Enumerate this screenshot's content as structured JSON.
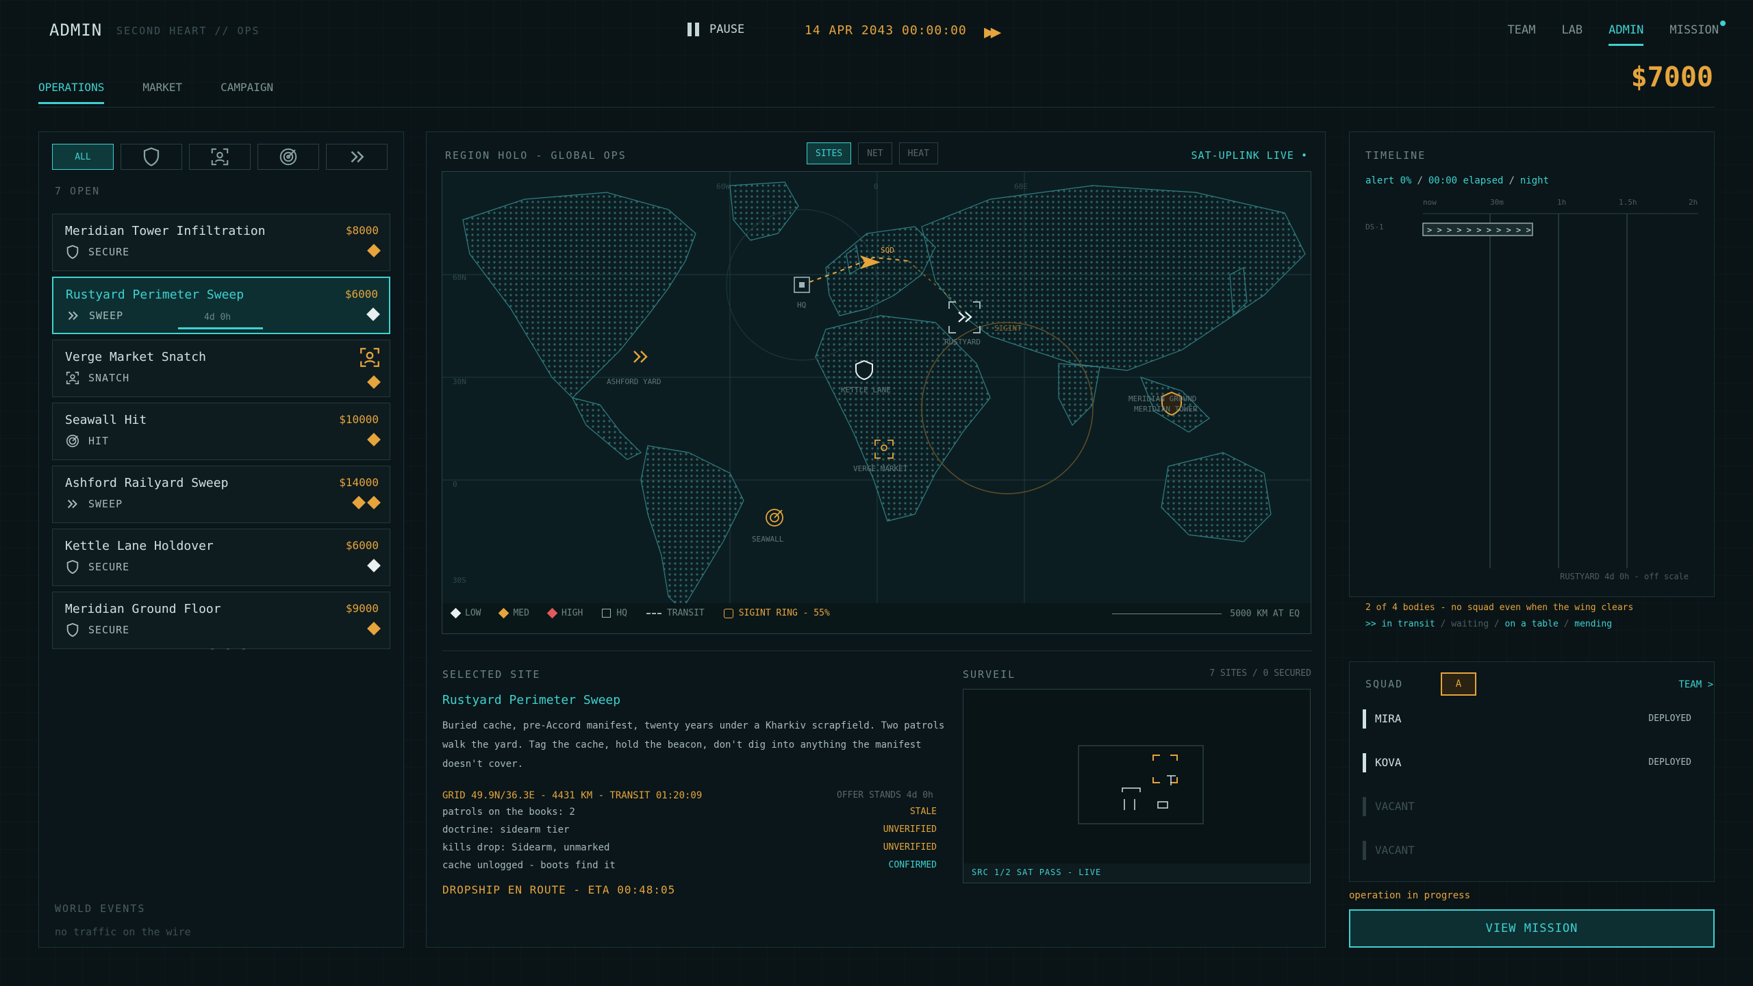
{
  "header": {
    "brand": "ADMIN",
    "sub_brand": "SECOND HEART // OPS",
    "pause_label": "PAUSE",
    "date": "14 APR 2043  00:00:00",
    "nav": [
      "TEAM",
      "LAB",
      "ADMIN",
      "MISSION"
    ],
    "active_nav": "ADMIN",
    "tabs": [
      "OPERATIONS",
      "MARKET",
      "CAMPAIGN"
    ],
    "active_tab": "OPERATIONS",
    "money": "$7000"
  },
  "operations": {
    "filter_all": "ALL",
    "open_count": "7 OPEN",
    "items": [
      {
        "name": "Meridian Tower Infiltration",
        "reward": "$8000",
        "type": "SECURE",
        "icon": "shield-icon",
        "difficulty": [
          "med"
        ]
      },
      {
        "name": "Rustyard Perimeter Sweep",
        "reward": "$6000",
        "type": "SWEEP",
        "icon": "chevrons-icon",
        "difficulty": [
          "low"
        ],
        "timer": "4d 0h"
      },
      {
        "name": "Verge Market Snatch",
        "reward": "",
        "type": "SNATCH",
        "icon": "target-person-icon",
        "difficulty": [
          "med"
        ]
      },
      {
        "name": "Seawall Hit",
        "reward": "$10000",
        "type": "HIT",
        "icon": "crosshair-icon",
        "difficulty": [
          "med"
        ]
      },
      {
        "name": "Ashford Railyard Sweep",
        "reward": "$14000",
        "type": "SWEEP",
        "icon": "chevrons-icon",
        "difficulty": [
          "med",
          "med"
        ]
      },
      {
        "name": "Kettle Lane Holdover",
        "reward": "$6000",
        "type": "SECURE",
        "icon": "shield-icon",
        "difficulty": [
          "low"
        ]
      },
      {
        "name": "Meridian Ground Floor",
        "reward": "$9000",
        "type": "SECURE",
        "icon": "shield-icon",
        "difficulty": [
          "med"
        ]
      }
    ],
    "more": "- - -",
    "world_events_title": "WORLD EVENTS",
    "world_events_text": "no traffic on the wire"
  },
  "map": {
    "title": "REGION HOLO - GLOBAL OPS",
    "modes": [
      "SITES",
      "NET",
      "HEAT"
    ],
    "active_mode": "SITES",
    "uplink": "SAT-UPLINK LIVE •",
    "labels": {
      "hq": "HQ",
      "sqd": "SQD",
      "rustyard": "RUSTYARD",
      "sigint": "SIGINT",
      "kettle": "KETTLE LANE",
      "ashford": "ASHFORD YARD",
      "verge": "VERGE MARKET",
      "seawall": "SEAWALL",
      "meridian": "MERIDIAN GROUND",
      "meridian_tower": "MERIDIAN TOWER",
      "lat60": "60N",
      "lat30": "30N",
      "lat0": "0",
      "lat30s": "30S",
      "lon60w": "60W",
      "lon0": "0",
      "lon60e": "60E"
    },
    "legend": {
      "low": "LOW",
      "med": "MED",
      "high": "HIGH",
      "hq": "HQ",
      "transit": "TRANSIT",
      "sigint": "SIGINT RING - 55%"
    },
    "scale": "5000 KM AT EQ"
  },
  "selected_site": {
    "label": "SELECTED SITE",
    "name": "Rustyard Perimeter Sweep",
    "description": "Buried cache, pre-Accord manifest, twenty years under a Kharkiv scrapfield. Two patrols walk the yard. Tag the cache, hold the beacon, don't dig into anything the manifest doesn't cover.",
    "grid": "GRID 49.9N/36.3E - 4431 KM - TRANSIT 01:20:09",
    "offer": "OFFER STANDS 4d 0h",
    "intel": [
      {
        "text": "patrols on the books: 2",
        "status": "STALE",
        "ok": false
      },
      {
        "text": "doctrine: sidearm tier",
        "status": "UNVERIFIED",
        "ok": false
      },
      {
        "text": "kills drop: Sidearm, unmarked",
        "status": "UNVERIFIED",
        "ok": false
      },
      {
        "text": "cache unlogged - boots find it",
        "status": "CONFIRMED",
        "ok": true
      }
    ],
    "dropship": "DROPSHIP EN ROUTE - ETA 00:48:05"
  },
  "surveil": {
    "label": "SURVEIL",
    "count": "7 SITES / 0 SECURED",
    "footer": "SRC 1/2  SAT PASS - LIVE"
  },
  "timeline": {
    "title": "TIMELINE",
    "alert": "alert 0%",
    "elapsed": "00:00 elapsed",
    "phase": "night",
    "ticks": [
      "now",
      "30m",
      "1h",
      "1.5h",
      "2h"
    ],
    "row_label": "DS-1",
    "offscale": "RUSTYARD 4d 0h - off scale",
    "note1": "2 of 4 bodies - no squad even when the wing clears",
    "note2_parts": [
      ">> in transit",
      "waiting",
      "on a table",
      "mending"
    ]
  },
  "squad": {
    "label": "SQUAD",
    "chip": "A",
    "team_link": "TEAM >",
    "members": [
      {
        "name": "MIRA",
        "status": "DEPLOYED",
        "vacant": false
      },
      {
        "name": "KOVA",
        "status": "DEPLOYED",
        "vacant": false
      },
      {
        "name": "VACANT",
        "status": "",
        "vacant": true
      },
      {
        "name": "VACANT",
        "status": "",
        "vacant": true
      }
    ],
    "progress": "operation in progress",
    "view_button": "VIEW MISSION"
  }
}
